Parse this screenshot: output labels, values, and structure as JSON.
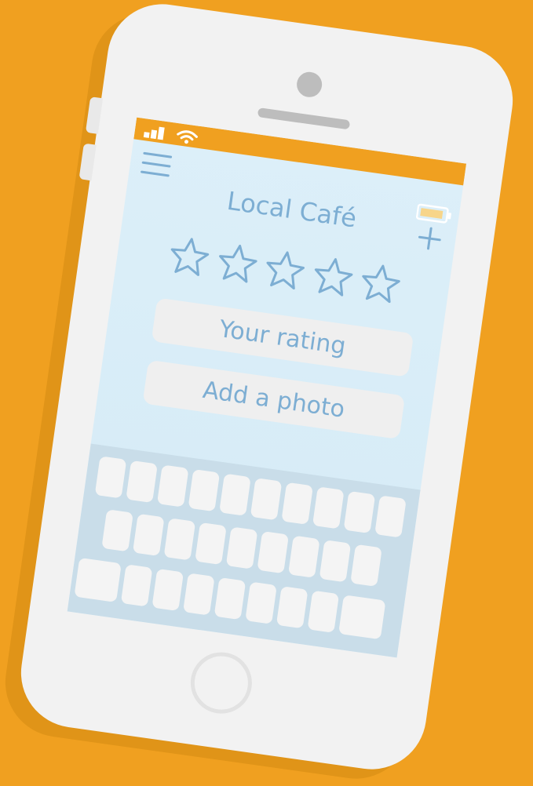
{
  "app": {
    "title": "Local Café"
  },
  "rating": {
    "stars_total": 5,
    "stars_filled": 0
  },
  "fields": {
    "rating_label": "Your rating",
    "photo_label": "Add a photo"
  },
  "colors": {
    "background": "#F0A020",
    "accent": "#7DAED3",
    "status_bar": "#F0A020",
    "screen": "#DCEFF9",
    "keyboard": "#C9DDE9",
    "key": "#F4F4F4"
  },
  "icons": {
    "menu": "hamburger-menu-icon",
    "add": "plus-icon",
    "signal": "signal-icon",
    "wifi": "wifi-icon",
    "battery": "battery-icon",
    "star": "star-outline-icon"
  }
}
